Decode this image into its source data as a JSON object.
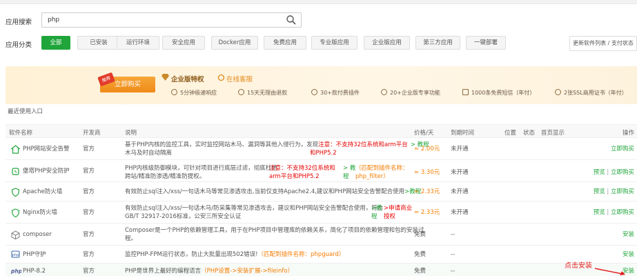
{
  "search": {
    "label": "应用搜索",
    "value": "php"
  },
  "category": {
    "label": "应用分类",
    "items": [
      "全部",
      "已安装",
      "运行环境",
      "安全应用",
      "Docker应用",
      "免费应用",
      "专业版应用",
      "企业版应用",
      "第三方应用",
      "一键部署"
    ],
    "active": "全部"
  },
  "update_button": "更新软件列表 / 支付状态",
  "banner": {
    "badge": "推荐",
    "buy": "立即购买",
    "title": "企业版特权",
    "service": "在线客服",
    "perks": [
      "5分钟极速响应",
      "15天无理由退款",
      "30+款付费插件",
      "20+企业版专享功能",
      "1000条免费短信（年付）",
      "2张SSL商用证书（年付）"
    ]
  },
  "recent": "最近使用入口",
  "columns": [
    "软件名称",
    "开发商",
    "说明",
    "价格/天",
    "到期时间",
    "位置",
    "状态",
    "首页显示",
    "操作"
  ],
  "rows": [
    {
      "name": "PHP网站安全告警",
      "dev": "官方",
      "desc1": "基于PHP内核的监控工具，实时监控网站木马、漏洞等其他入侵行为，发现",
      "desc2": "木马及时自动隔离",
      "warn1": "注意：不支持32位系统和arm平台",
      "warn2": "和PHP5.2",
      "tut": "> 教程",
      "price": "≈ 2.00元",
      "expire": "未开通",
      "op": "立即购买"
    },
    {
      "name": "堡塔PHP安全防护",
      "dev": "官方",
      "desc1": "PHP内核级防御模块，可针对项目进行底层过滤，彻底杜绝",
      "desc2": "跨站/精准防渗透/精准防提权。",
      "warn1": "注意：不支持32位系统和",
      "warn2": "arm平台和PHP5.2",
      "tut": "> 教",
      "tut2": "程",
      "match1": "（匹配到插件名称：",
      "match2": "php_filter）",
      "price": "≈ 3.30元",
      "expire": "未开通",
      "op1": "预览",
      "op2": "立即购买"
    },
    {
      "name": "Apache防火墙",
      "dev": "官方",
      "desc": "有效防止sql注入/xss/一句话木马等常见渗透攻击,当前仅支持Apache2.4,建议和PHP网站安全告警配合使用",
      "tut": ">教程",
      "price": "≈ 2.33元",
      "expire": "未开通",
      "op1": "预览",
      "op2": "立即购买"
    },
    {
      "name": "Nginx防火墙",
      "dev": "官方",
      "desc1": "有效防止sql注入/xss/一句话木马/防采集等常见渗透攻击，建议和PHP网站安全告警配合使用，符合",
      "desc2": "GB/T 32917-2016标准，公安三所安全认证",
      "tut1": ">教",
      "tut2": "程",
      "apply1": ">申请商业",
      "apply2": "授权",
      "price": "≈ 2.33元",
      "expire": "未开通",
      "op1": "预览",
      "op2": "立即购买"
    },
    {
      "name": "composer",
      "dev": "官方",
      "desc1": "Composer是一个PHP的依赖管理工具，用于在PHP项目中管理库的依赖关系，简化了项目的依赖管理和包的安装过",
      "desc2": "程。",
      "price": "免费",
      "expire": "--",
      "op": "安装"
    },
    {
      "name": "PHP守护",
      "dev": "官方",
      "desc": "监控PHP-FPM运行状态，防止大批量出现502错误!",
      "match": "（匹配到插件名称：phpguard）",
      "price": "免费",
      "expire": "--",
      "op": "安装"
    },
    {
      "name": "PHP-8.2",
      "dev": "官方",
      "desc": "PHP是世界上最好的编程语言",
      "extra": "（PHP设置->安装扩展->fileinfo）",
      "price": "免费",
      "expire": "--",
      "op": "安装"
    }
  ],
  "annotation": "点击安装"
}
